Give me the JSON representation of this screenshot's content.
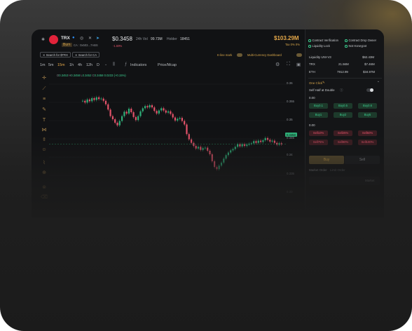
{
  "token": {
    "symbol": "TRX",
    "tag": "Burn",
    "ca": "CA : 0x503...7ABS",
    "price": "$0.3458",
    "vol_label": "24h Vol",
    "vol": "99.73M",
    "holder_label": "Holder",
    "holder": "18451",
    "change": "-1.59%",
    "market_cap": "$103.29M",
    "tax": "Tax 0% 0%"
  },
  "search": {
    "by_symbol": "Search for $TRX",
    "by_ca": "Search for CA"
  },
  "toggles": {
    "kline_mark": "K-line mark",
    "multi_currency": "Multi-Currency Dashboard"
  },
  "timeframes": [
    "1m",
    "5m",
    "15m",
    "1h",
    "4h",
    "12h",
    "D"
  ],
  "active_timeframe": "15m",
  "indicators_label": "Indicators",
  "price_mcap_label": "Price/Mcap",
  "ohlc": {
    "o": "0.3453",
    "h": "0.3458",
    "l": "0.3452",
    "c": "0.3458",
    "change": "0.0233 (+0.15%)"
  },
  "y_ticks": [
    "0.36",
    "0.355",
    "0.35",
    "0.3458",
    "0.345",
    "0.34",
    "0.335",
    "0.33"
  ],
  "current_price_tag": "0.3458",
  "chart_data": {
    "type": "candlestick",
    "ylim": [
      0.33,
      0.362
    ],
    "close": [
      0.3566,
      0.3562,
      0.3569,
      0.3565,
      0.3572,
      0.3568,
      0.3574,
      0.357,
      0.3571,
      0.3566,
      0.3558,
      0.3546,
      0.3531,
      0.3524,
      0.3516,
      0.351,
      0.352,
      0.3531,
      0.3541,
      0.3537,
      0.3548,
      0.354,
      0.3529,
      0.3522,
      0.3531,
      0.3542,
      0.3549,
      0.3554,
      0.3551,
      0.3556,
      0.3551,
      0.3543,
      0.3537,
      0.3544,
      0.3549,
      0.3544,
      0.3539,
      0.3542,
      0.3536,
      0.3528,
      0.3521,
      0.3525,
      0.3527,
      0.352,
      0.3512,
      0.349,
      0.3478,
      0.347,
      0.3463,
      0.3457,
      0.3461,
      0.3454,
      0.3458,
      0.3459,
      0.3452,
      0.3444,
      0.3428,
      0.3415,
      0.341,
      0.3418,
      0.3425,
      0.3434,
      0.3442,
      0.3448,
      0.3453,
      0.3456,
      0.3461,
      0.3467,
      0.3462,
      0.3467,
      0.3463,
      0.3466,
      0.3468,
      0.3469,
      0.3474,
      0.347,
      0.3475,
      0.3472,
      0.3476,
      0.3481,
      0.3477,
      0.3473,
      0.3475,
      0.347,
      0.3466,
      0.3469,
      0.3467
    ]
  },
  "right_panel": {
    "checks": [
      "Contract Verification",
      "Contract Drop Owner",
      "Liquidity Lock",
      "Not Honeypot"
    ],
    "liquidity_title": "Liquidity UNI-V3",
    "liquidity_total": "$62.43M",
    "pairs": [
      {
        "name": "TRX",
        "amount": "21.56M",
        "usd": "$7.46M"
      },
      {
        "name": "ETH",
        "amount": "7912.99",
        "usd": "$34.97M"
      }
    ],
    "one_click": "One Click",
    "self_half": "Self Half at Double",
    "buy_amount": "0.00",
    "buy_buttons": [
      "Buy0.1",
      "Buy0.5",
      "Buy0.6",
      "Buy1",
      "Buy2",
      "Buy5"
    ],
    "sell_amount": "0.00",
    "sell_buttons": [
      "Sell10%",
      "Sell25%",
      "Sell50%",
      "Sell75%",
      "Sell90%",
      "Sell100%"
    ],
    "tab_buy": "Buy",
    "tab_sell": "Sell",
    "order_market": "Market Order",
    "order_limit": "Limit Order",
    "market_label": "Market"
  }
}
